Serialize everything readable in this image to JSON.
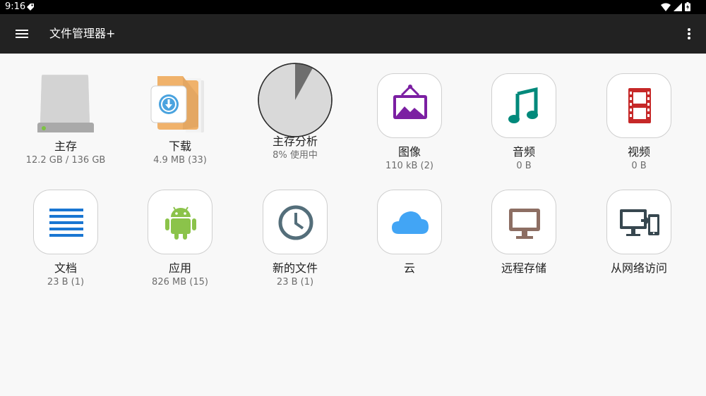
{
  "status": {
    "time": "9:16"
  },
  "app": {
    "title": "文件管理器+"
  },
  "tiles": [
    {
      "label": "主存",
      "sub": "12.2 GB / 136 GB",
      "icon": "drive-icon"
    },
    {
      "label": "下载",
      "sub": "4.9 MB (33)",
      "icon": "download-folder-icon"
    },
    {
      "label": "主存分析",
      "sub": "8% 使用中",
      "icon": "pie-chart-icon",
      "used_fraction": 0.08
    },
    {
      "label": "图像",
      "sub": "110 kB (2)",
      "icon": "image-frame-icon"
    },
    {
      "label": "音频",
      "sub": "0 B",
      "icon": "music-note-icon"
    },
    {
      "label": "视频",
      "sub": "0 B",
      "icon": "film-icon"
    },
    {
      "label": "文档",
      "sub": "23 B (1)",
      "icon": "document-lines-icon"
    },
    {
      "label": "应用",
      "sub": "826 MB (15)",
      "icon": "android-icon"
    },
    {
      "label": "新的文件",
      "sub": "23 B (1)",
      "icon": "clock-icon"
    },
    {
      "label": "云",
      "sub": "",
      "icon": "cloud-icon"
    },
    {
      "label": "远程存储",
      "sub": "",
      "icon": "monitor-icon"
    },
    {
      "label": "从网络访问",
      "sub": "",
      "icon": "devices-icon"
    }
  ],
  "colors": {
    "app_bar": "#222222",
    "background": "#f8f8f8",
    "image_purple": "#7b1fa2",
    "audio_teal": "#00897b",
    "video_red": "#c62828",
    "doc_blue": "#1976d2",
    "android_green": "#8bc34a",
    "clock_slate": "#546e7a",
    "cloud_blue": "#42a5f5",
    "monitor_brown": "#8d6e63",
    "devices_dark": "#37474f"
  }
}
